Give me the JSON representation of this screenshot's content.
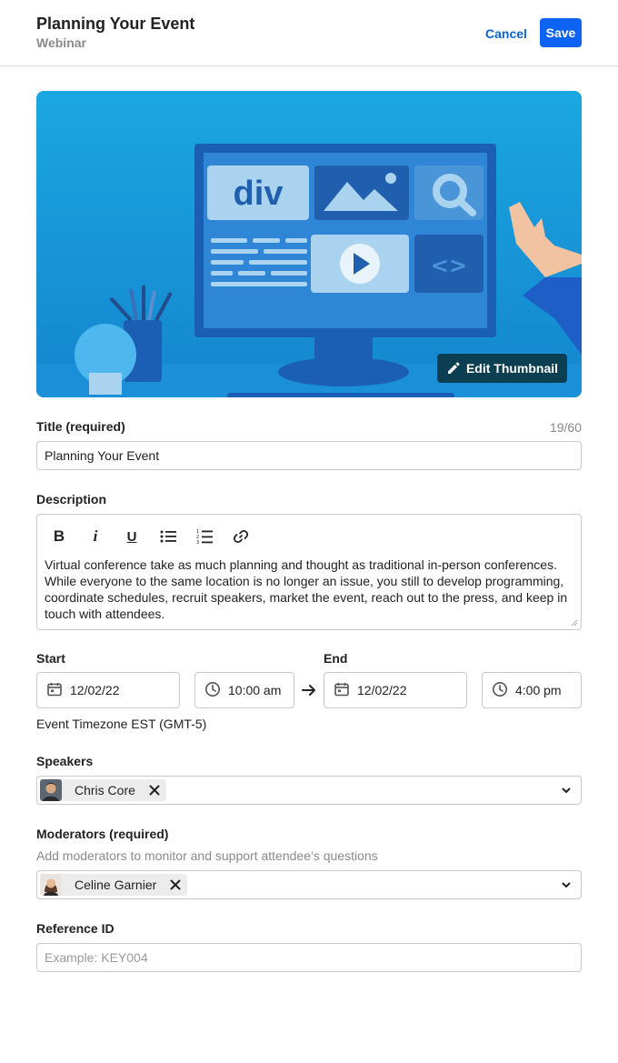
{
  "header": {
    "title": "Planning Your Event",
    "subtitle": "Webinar",
    "cancel_label": "Cancel",
    "save_label": "Save"
  },
  "thumbnail": {
    "edit_label": "Edit Thumbnail",
    "tile_text": "div"
  },
  "title_field": {
    "label": "Title (required)",
    "counter": "19/60",
    "value": "Planning Your Event"
  },
  "description": {
    "label": "Description",
    "toolbar": [
      "bold",
      "italic",
      "underline",
      "bulleted-list",
      "numbered-list",
      "link"
    ],
    "toolbar_glyphs": {
      "bold": "B",
      "italic": "i",
      "underline": "U"
    },
    "text": "Virtual conference take as much planning and thought as traditional in-person conferences. While everyone to the same location is no longer an issue, you still to develop programming, coordinate schedules, recruit speakers, market the event, reach out to the press, and keep in touch with attendees."
  },
  "schedule": {
    "start_label": "Start",
    "end_label": "End",
    "start_date": "12/02/22",
    "start_time": "10:00 am",
    "end_date": "12/02/22",
    "end_time": "4:00 pm",
    "timezone": "Event Timezone EST (GMT-5)"
  },
  "speakers": {
    "label": "Speakers",
    "selected": [
      "Chris Core"
    ]
  },
  "moderators": {
    "label": "Moderators (required)",
    "helper": "Add moderators to monitor and support attendee’s questions",
    "selected": [
      "Celine Garnier"
    ]
  },
  "reference": {
    "label": "Reference ID",
    "placeholder": "Example: KEY004"
  },
  "colors": {
    "primary": "#0d63f3",
    "link": "#0b63d9",
    "edit_button_bg": "#0d3f52",
    "border": "#c9c9c9",
    "muted_text": "#8a8a8a"
  }
}
